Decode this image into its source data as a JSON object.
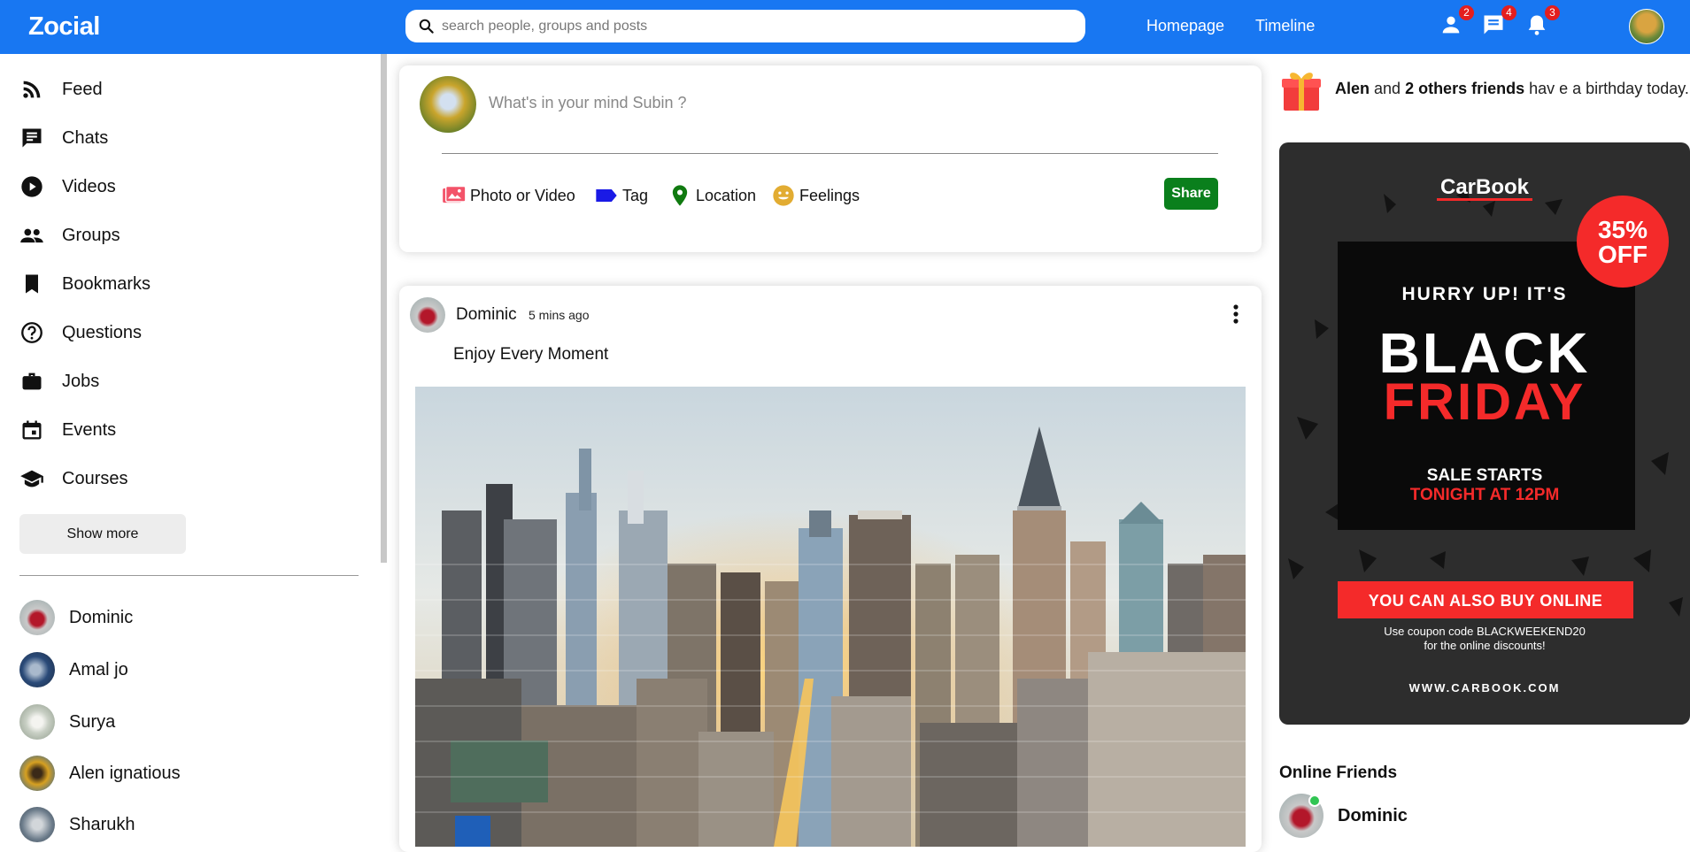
{
  "header": {
    "logo": "Zocial",
    "search_placeholder": "search people, groups and posts",
    "links": [
      "Homepage",
      "Timeline"
    ],
    "badges": {
      "friends": "2",
      "messages": "4",
      "notifications": "3"
    }
  },
  "sidebar": {
    "items": [
      {
        "label": "Feed",
        "icon": "rss-icon"
      },
      {
        "label": "Chats",
        "icon": "chat-icon"
      },
      {
        "label": "Videos",
        "icon": "play-circle-icon"
      },
      {
        "label": "Groups",
        "icon": "group-icon"
      },
      {
        "label": "Bookmarks",
        "icon": "bookmark-icon"
      },
      {
        "label": "Questions",
        "icon": "help-circle-icon"
      },
      {
        "label": "Jobs",
        "icon": "briefcase-icon"
      },
      {
        "label": "Events",
        "icon": "calendar-icon"
      },
      {
        "label": "Courses",
        "icon": "school-icon"
      }
    ],
    "show_more": "Show more",
    "friends": [
      {
        "name": "Dominic",
        "color": "#b3172a"
      },
      {
        "name": "Amal jo",
        "color": "#2a4a78"
      },
      {
        "name": "Surya",
        "color": "#d8d8d0"
      },
      {
        "name": "Alen ignatious",
        "color": "#d6a021"
      },
      {
        "name": "Sharukh",
        "color": "#6b7b8a"
      }
    ]
  },
  "share": {
    "placeholder": "What's in your mind Subin ?",
    "options": [
      "Photo or Video",
      "Tag",
      "Location",
      "Feelings"
    ],
    "button": "Share"
  },
  "post": {
    "user": "Dominic",
    "time": "5 mins ago",
    "text": "Enjoy Every Moment"
  },
  "birthday": {
    "name": "Alen",
    "connector": " and ",
    "others": "2 others friends",
    "suffix": " hav e a birthday today."
  },
  "ad": {
    "brand": "CarBook",
    "discount": [
      "35%",
      "OFF"
    ],
    "line1": "HURRY UP! IT'S",
    "line2": "BLACK",
    "line3": "FRIDAY",
    "sale1": "SALE STARTS",
    "sale2": "TONIGHT AT 12PM",
    "banner": "YOU CAN ALSO BUY ONLINE",
    "coupon1": "Use coupon code BLACKWEEKEND20",
    "coupon2": "for the online discounts!",
    "url": "WWW.CARBOOK.COM"
  },
  "online": {
    "title": "Online Friends",
    "friends": [
      "Dominic"
    ]
  },
  "colors": {
    "brand": "#1877f2",
    "share_button": "#0a7f1c",
    "badge": "#e41e1e",
    "ad_red": "#f42a2a",
    "online": "#31c553"
  }
}
